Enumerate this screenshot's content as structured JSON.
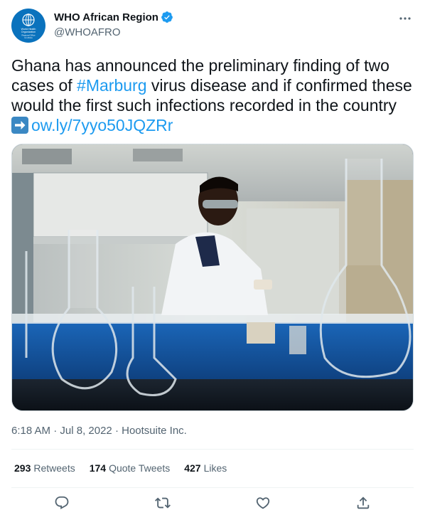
{
  "author": {
    "display_name": "WHO African Region",
    "handle": "@WHOAFRO",
    "avatar_text": [
      "World Health",
      "Organization",
      "Regional Office",
      "for Africa"
    ]
  },
  "tweet": {
    "text_before": "Ghana has announced the preliminary finding of two cases of ",
    "hashtag": "#Marburg",
    "text_after": " virus disease and if confirmed these would the first such infections recorded in the country ",
    "arrow_icon": "right-arrow-emoji",
    "link": "ow.ly/7yyo50JQZRr"
  },
  "meta": {
    "time": "6:18 AM",
    "separator": "·",
    "date": "Jul 8, 2022",
    "source": "Hootsuite Inc."
  },
  "stats": {
    "retweets_count": "293",
    "retweets_label": "Retweets",
    "quotes_count": "174",
    "quotes_label": "Quote Tweets",
    "likes_count": "427",
    "likes_label": "Likes"
  },
  "icons": {
    "reply": "reply-icon",
    "retweet": "retweet-icon",
    "like": "like-icon",
    "share": "share-icon",
    "more": "more-icon",
    "verified": "verified-badge-icon"
  },
  "colors": {
    "accent": "#1d9bf0",
    "text": "#0f1419",
    "muted": "#536471",
    "avatar_bg": "#0a72bd"
  }
}
